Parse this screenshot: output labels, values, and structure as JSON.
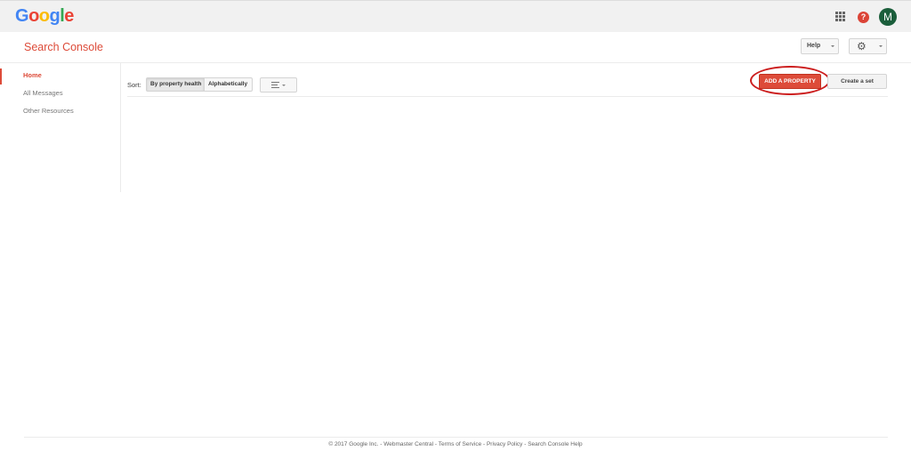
{
  "topbar": {
    "logo_letters": [
      {
        "ch": "G",
        "color": "#4285f4"
      },
      {
        "ch": "o",
        "color": "#ea4335"
      },
      {
        "ch": "o",
        "color": "#fbbc05"
      },
      {
        "ch": "g",
        "color": "#4285f4"
      },
      {
        "ch": "l",
        "color": "#34a853"
      },
      {
        "ch": "e",
        "color": "#ea4335"
      }
    ],
    "notification_symbol": "?",
    "avatar_initial": "M",
    "icons": [
      "apps-grid-icon",
      "notifications-icon",
      "avatar"
    ]
  },
  "header": {
    "title": "Search Console",
    "help_label": "Help",
    "settings_icon": "gear-icon"
  },
  "sidebar": {
    "items": [
      {
        "label": "Home",
        "active": true
      },
      {
        "label": "All Messages",
        "active": false
      },
      {
        "label": "Other Resources",
        "active": false
      }
    ]
  },
  "toolbar": {
    "sort_label": "Sort:",
    "sort_options": [
      {
        "label": "By property health",
        "selected": true
      },
      {
        "label": "Alphabetically",
        "selected": false
      }
    ],
    "view_icon": "list-view-icon",
    "add_property_label": "ADD A PROPERTY",
    "create_set_label": "Create a set"
  },
  "footer": {
    "copyright": "© 2017 Google Inc.",
    "links": [
      "Webmaster Central",
      "Terms of Service",
      "Privacy Policy",
      "Search Console Help"
    ],
    "separator": " - "
  },
  "colors": {
    "accent": "#dd4b39",
    "topbar_bg": "#f1f1f1",
    "avatar_bg": "#1b5e3b",
    "highlight_ring": "#cc1e1e"
  }
}
